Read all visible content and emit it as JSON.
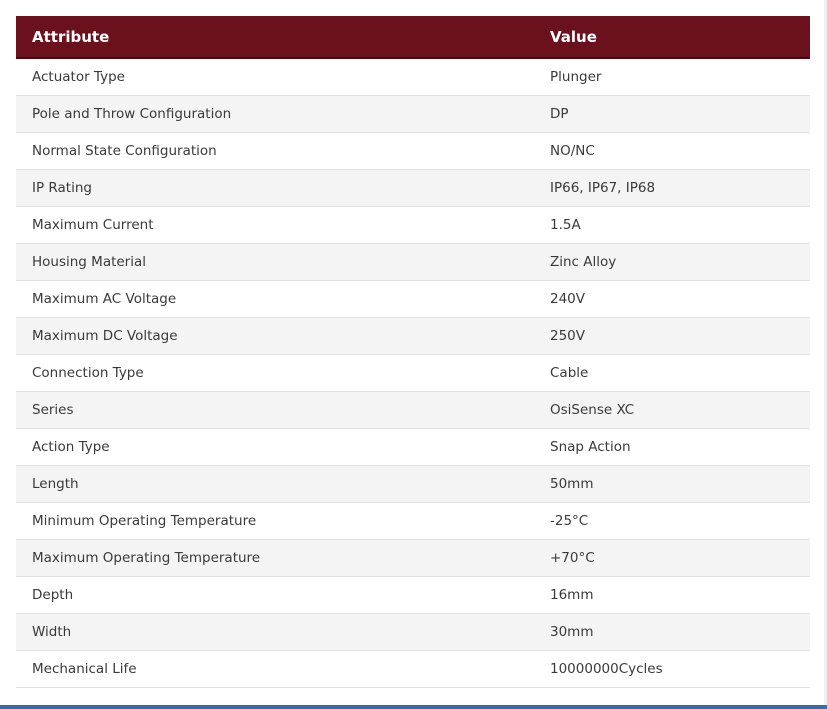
{
  "table": {
    "headers": {
      "attribute": "Attribute",
      "value": "Value"
    },
    "rows": [
      {
        "attribute": "Actuator Type",
        "value": "Plunger"
      },
      {
        "attribute": "Pole and Throw Configuration",
        "value": "DP"
      },
      {
        "attribute": "Normal State Configuration",
        "value": "NO/NC"
      },
      {
        "attribute": "IP Rating",
        "value": "IP66, IP67, IP68"
      },
      {
        "attribute": "Maximum Current",
        "value": "1.5A"
      },
      {
        "attribute": "Housing Material",
        "value": "Zinc Alloy"
      },
      {
        "attribute": "Maximum AC Voltage",
        "value": "240V"
      },
      {
        "attribute": "Maximum DC Voltage",
        "value": "250V"
      },
      {
        "attribute": "Connection Type",
        "value": "Cable"
      },
      {
        "attribute": "Series",
        "value": "OsiSense XC"
      },
      {
        "attribute": "Action Type",
        "value": "Snap Action"
      },
      {
        "attribute": "Length",
        "value": "50mm"
      },
      {
        "attribute": "Minimum Operating Temperature",
        "value": "-25°C"
      },
      {
        "attribute": "Maximum Operating Temperature",
        "value": "+70°C"
      },
      {
        "attribute": "Depth",
        "value": "16mm"
      },
      {
        "attribute": "Width",
        "value": "30mm"
      },
      {
        "attribute": "Mechanical Life",
        "value": "10000000Cycles"
      }
    ]
  },
  "colors": {
    "header_background": "#6b111e",
    "header_text": "#ffffff",
    "row_alt_background": "#f4f4f4",
    "bottom_rule": "#3b6aa4"
  }
}
